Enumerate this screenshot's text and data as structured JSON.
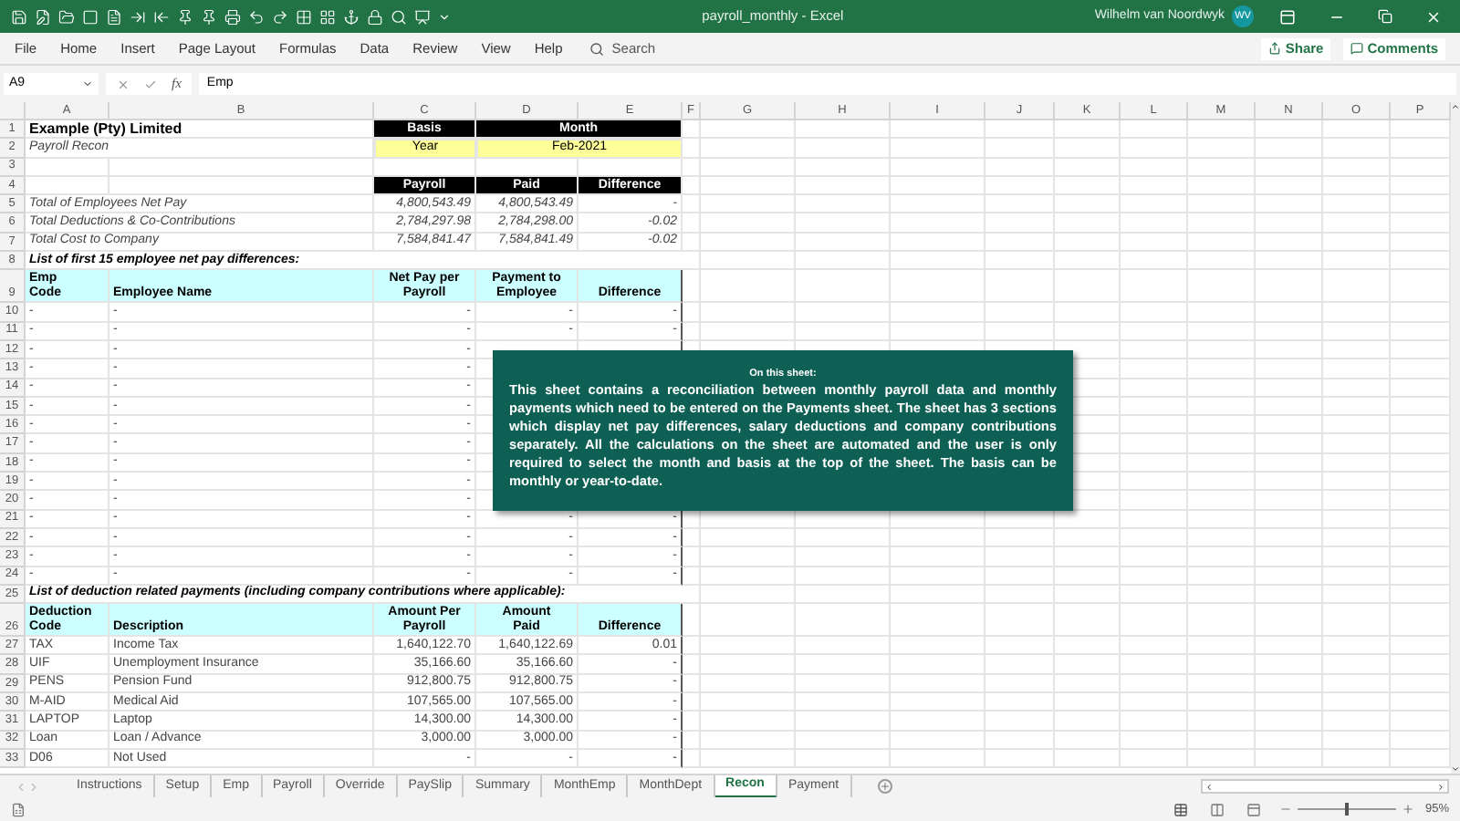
{
  "title_bar": {
    "title": "payroll_monthly  -  Excel",
    "user": "Wilhelm van Noordwyk",
    "avatar": "WV"
  },
  "menu": {
    "items": [
      {
        "label": "File",
        "selected": false
      },
      {
        "label": "Home",
        "selected": false
      },
      {
        "label": "Insert",
        "selected": false
      },
      {
        "label": "Page Layout",
        "selected": false
      },
      {
        "label": "Formulas",
        "selected": false
      },
      {
        "label": "Data",
        "selected": false
      },
      {
        "label": "Review",
        "selected": false
      },
      {
        "label": "View",
        "selected": false
      },
      {
        "label": "Help",
        "selected": false
      }
    ],
    "search": "Search",
    "share": "Share",
    "comments": "Comments"
  },
  "formula_bar": {
    "name_box": "A9",
    "function_label": "fx",
    "formula": "Emp"
  },
  "columns": [
    "A",
    "B",
    "C",
    "D",
    "E",
    "F",
    "G",
    "H",
    "I",
    "J",
    "K",
    "L",
    "M",
    "N",
    "O",
    "P"
  ],
  "rows": [
    {
      "number": "1",
      "kind": "title",
      "cells": [
        {
          "text": "Example (Pty) Limited",
          "kind": "bold"
        },
        {
          "text": "Basis",
          "kind": "black_header"
        },
        {
          "text": "Month",
          "kind": "black_header"
        }
      ]
    },
    {
      "number": "2",
      "kind": "title",
      "cells": [
        {
          "text": "Payroll Recon",
          "kind": "italic"
        },
        {
          "text": "Year",
          "kind": "yellow"
        },
        {
          "text": "Feb-2021",
          "kind": "yellow"
        }
      ]
    },
    {
      "number": "3",
      "kind": "blank",
      "cells": []
    },
    {
      "number": "4",
      "kind": "summary_header",
      "cells": [
        {
          "text": "Payroll",
          "kind": "black_header"
        },
        {
          "text": "Paid",
          "kind": "black_header"
        },
        {
          "text": "Difference",
          "kind": "black_header"
        }
      ]
    },
    {
      "number": "5",
      "kind": "summary",
      "cells": [
        {
          "text": "Total of Employees Net Pay",
          "kind": "italic"
        },
        {
          "text": "4,800,543.49",
          "kind": "italic_number"
        },
        {
          "text": "4,800,543.49",
          "kind": "italic_number"
        },
        {
          "text": "-",
          "kind": "italic_number"
        }
      ]
    },
    {
      "number": "6",
      "kind": "summary",
      "cells": [
        {
          "text": "Total Deductions & Co-Contributions",
          "kind": "italic"
        },
        {
          "text": "2,784,297.98",
          "kind": "italic_number"
        },
        {
          "text": "2,784,298.00",
          "kind": "italic_number"
        },
        {
          "text": "-0.02",
          "kind": "italic_number"
        }
      ]
    },
    {
      "number": "7",
      "kind": "summary",
      "cells": [
        {
          "text": "Total Cost to Company",
          "kind": "italic"
        },
        {
          "text": "7,584,841.47",
          "kind": "italic_number"
        },
        {
          "text": "7,584,841.49",
          "kind": "italic_number"
        },
        {
          "text": "-0.02",
          "kind": "italic_number"
        }
      ]
    },
    {
      "number": "8",
      "kind": "section",
      "cells": [
        {
          "text": "List of first 15 employee net pay differences:",
          "kind": "section"
        }
      ]
    },
    {
      "number": "9",
      "kind": "table",
      "cells": [
        {
          "text": "Emp\nCode",
          "kind": "column_header"
        },
        {
          "text": "Employee Name",
          "kind": "column_header"
        },
        {
          "text": "Net Pay per\nPayroll",
          "kind": "column_header"
        },
        {
          "text": "Payment to\nEmployee",
          "kind": "column_header"
        },
        {
          "text": "Difference",
          "kind": "column_header"
        }
      ]
    },
    {
      "number": "10",
      "kind": "table",
      "cells": [
        {
          "text": "-",
          "kind": "plain"
        },
        {
          "text": "-",
          "kind": "plain"
        },
        {
          "text": "-",
          "kind": "number"
        },
        {
          "text": "-",
          "kind": "number"
        },
        {
          "text": "-",
          "kind": "number"
        }
      ]
    },
    {
      "number": "11",
      "kind": "table",
      "cells": [
        {
          "text": "-",
          "kind": "plain"
        },
        {
          "text": "-",
          "kind": "plain"
        },
        {
          "text": "-",
          "kind": "number"
        },
        {
          "text": "-",
          "kind": "number"
        },
        {
          "text": "-",
          "kind": "number"
        }
      ]
    },
    {
      "number": "12",
      "kind": "table",
      "cells": [
        {
          "text": "-",
          "kind": "plain"
        },
        {
          "text": "-",
          "kind": "plain"
        },
        {
          "text": "-",
          "kind": "number"
        }
      ]
    },
    {
      "number": "13",
      "kind": "table",
      "cells": [
        {
          "text": "-",
          "kind": "plain"
        },
        {
          "text": "-",
          "kind": "plain"
        },
        {
          "text": "-",
          "kind": "number"
        }
      ]
    },
    {
      "number": "14",
      "kind": "table",
      "cells": [
        {
          "text": "-",
          "kind": "plain"
        },
        {
          "text": "-",
          "kind": "plain"
        },
        {
          "text": "-",
          "kind": "number"
        }
      ]
    },
    {
      "number": "15",
      "kind": "table",
      "cells": [
        {
          "text": "-",
          "kind": "plain"
        },
        {
          "text": "-",
          "kind": "plain"
        },
        {
          "text": "-",
          "kind": "number"
        }
      ]
    },
    {
      "number": "16",
      "kind": "table",
      "cells": [
        {
          "text": "-",
          "kind": "plain"
        },
        {
          "text": "-",
          "kind": "plain"
        },
        {
          "text": "-",
          "kind": "number"
        }
      ]
    },
    {
      "number": "17",
      "kind": "table",
      "cells": [
        {
          "text": "-",
          "kind": "plain"
        },
        {
          "text": "-",
          "kind": "plain"
        },
        {
          "text": "-",
          "kind": "number"
        }
      ]
    },
    {
      "number": "18",
      "kind": "table",
      "cells": [
        {
          "text": "-",
          "kind": "plain"
        },
        {
          "text": "-",
          "kind": "plain"
        },
        {
          "text": "-",
          "kind": "number"
        }
      ]
    },
    {
      "number": "19",
      "kind": "table",
      "cells": [
        {
          "text": "-",
          "kind": "plain"
        },
        {
          "text": "-",
          "kind": "plain"
        },
        {
          "text": "-",
          "kind": "number"
        }
      ]
    },
    {
      "number": "20",
      "kind": "table",
      "cells": [
        {
          "text": "-",
          "kind": "plain"
        },
        {
          "text": "-",
          "kind": "plain"
        },
        {
          "text": "-",
          "kind": "number"
        }
      ]
    },
    {
      "number": "21",
      "kind": "table",
      "cells": [
        {
          "text": "-",
          "kind": "plain"
        },
        {
          "text": "-",
          "kind": "plain"
        },
        {
          "text": "-",
          "kind": "number"
        },
        {
          "text": "-",
          "kind": "number"
        },
        {
          "text": "-",
          "kind": "number"
        }
      ]
    },
    {
      "number": "22",
      "kind": "table",
      "cells": [
        {
          "text": "-",
          "kind": "plain"
        },
        {
          "text": "-",
          "kind": "plain"
        },
        {
          "text": "-",
          "kind": "number"
        },
        {
          "text": "-",
          "kind": "number"
        },
        {
          "text": "-",
          "kind": "number"
        }
      ]
    },
    {
      "number": "23",
      "kind": "table",
      "cells": [
        {
          "text": "-",
          "kind": "plain"
        },
        {
          "text": "-",
          "kind": "plain"
        },
        {
          "text": "-",
          "kind": "number"
        },
        {
          "text": "-",
          "kind": "number"
        },
        {
          "text": "-",
          "kind": "number"
        }
      ]
    },
    {
      "number": "24",
      "kind": "table",
      "cells": [
        {
          "text": "-",
          "kind": "plain"
        },
        {
          "text": "-",
          "kind": "plain"
        },
        {
          "text": "-",
          "kind": "number"
        },
        {
          "text": "-",
          "kind": "number"
        },
        {
          "text": "-",
          "kind": "number"
        }
      ]
    },
    {
      "number": "25",
      "kind": "section",
      "cells": [
        {
          "text": "List of deduction related payments (including company contributions where applicable):",
          "kind": "section"
        }
      ]
    },
    {
      "number": "26",
      "kind": "table",
      "cells": [
        {
          "text": "Deduction\nCode",
          "kind": "column_header"
        },
        {
          "text": "Description",
          "kind": "column_header"
        },
        {
          "text": "Amount Per\nPayroll",
          "kind": "column_header"
        },
        {
          "text": "Amount\nPaid",
          "kind": "column_header"
        },
        {
          "text": "Difference",
          "kind": "column_header"
        }
      ]
    },
    {
      "number": "27",
      "kind": "table",
      "cells": [
        {
          "text": "TAX",
          "kind": "plain"
        },
        {
          "text": "Income Tax",
          "kind": "plain"
        },
        {
          "text": "1,640,122.70",
          "kind": "number"
        },
        {
          "text": "1,640,122.69",
          "kind": "number"
        },
        {
          "text": "0.01",
          "kind": "number"
        }
      ]
    },
    {
      "number": "28",
      "kind": "table",
      "cells": [
        {
          "text": "UIF",
          "kind": "plain"
        },
        {
          "text": "Unemployment Insurance",
          "kind": "plain"
        },
        {
          "text": "35,166.60",
          "kind": "number"
        },
        {
          "text": "35,166.60",
          "kind": "number"
        },
        {
          "text": "-",
          "kind": "number"
        }
      ]
    },
    {
      "number": "29",
      "kind": "table",
      "cells": [
        {
          "text": "PENS",
          "kind": "plain"
        },
        {
          "text": "Pension Fund",
          "kind": "plain"
        },
        {
          "text": "912,800.75",
          "kind": "number"
        },
        {
          "text": "912,800.75",
          "kind": "number"
        },
        {
          "text": "-",
          "kind": "number"
        }
      ]
    },
    {
      "number": "30",
      "kind": "table",
      "cells": [
        {
          "text": "M-AID",
          "kind": "plain"
        },
        {
          "text": "Medical Aid",
          "kind": "plain"
        },
        {
          "text": "107,565.00",
          "kind": "number"
        },
        {
          "text": "107,565.00",
          "kind": "number"
        },
        {
          "text": "-",
          "kind": "number"
        }
      ]
    },
    {
      "number": "31",
      "kind": "table",
      "cells": [
        {
          "text": "LAPTOP",
          "kind": "plain"
        },
        {
          "text": "Laptop",
          "kind": "plain"
        },
        {
          "text": "14,300.00",
          "kind": "number"
        },
        {
          "text": "14,300.00",
          "kind": "number"
        },
        {
          "text": "-",
          "kind": "number"
        }
      ]
    },
    {
      "number": "32",
      "kind": "table",
      "cells": [
        {
          "text": "Loan",
          "kind": "plain"
        },
        {
          "text": "Loan / Advance",
          "kind": "plain"
        },
        {
          "text": "3,000.00",
          "kind": "number"
        },
        {
          "text": "3,000.00",
          "kind": "number"
        },
        {
          "text": "-",
          "kind": "number"
        }
      ]
    },
    {
      "number": "33",
      "kind": "table",
      "cells": [
        {
          "text": "D06",
          "kind": "plain"
        },
        {
          "text": "Not Used",
          "kind": "plain"
        },
        {
          "text": "-",
          "kind": "number"
        },
        {
          "text": "-",
          "kind": "number"
        },
        {
          "text": "-",
          "kind": "number"
        }
      ]
    }
  ],
  "note": {
    "title": "On this sheet:",
    "body": "This sheet contains a reconciliation between monthly payroll data and monthly payments which need to be entered on the Payments sheet. The sheet has 3 sections which display net pay differences, salary deductions and company contributions separately. All the calculations on the sheet are automated and the user is only required to select the month and basis at the top of the sheet. The basis can be monthly or year-to-date."
  },
  "sheet_tabs": [
    {
      "label": "Instructions",
      "selected": false
    },
    {
      "label": "Setup",
      "selected": false
    },
    {
      "label": "Emp",
      "selected": false
    },
    {
      "label": "Payroll",
      "selected": false
    },
    {
      "label": "Override",
      "selected": false
    },
    {
      "label": "PaySlip",
      "selected": false
    },
    {
      "label": "Summary",
      "selected": false
    },
    {
      "label": "MonthEmp",
      "selected": false
    },
    {
      "label": "MonthDept",
      "selected": false
    },
    {
      "label": "Recon",
      "selected": true
    },
    {
      "label": "Payment",
      "selected": false
    }
  ],
  "status_bar": {
    "zoom": "95%",
    "zoom_slider": {
      "level": 0.48
    }
  }
}
